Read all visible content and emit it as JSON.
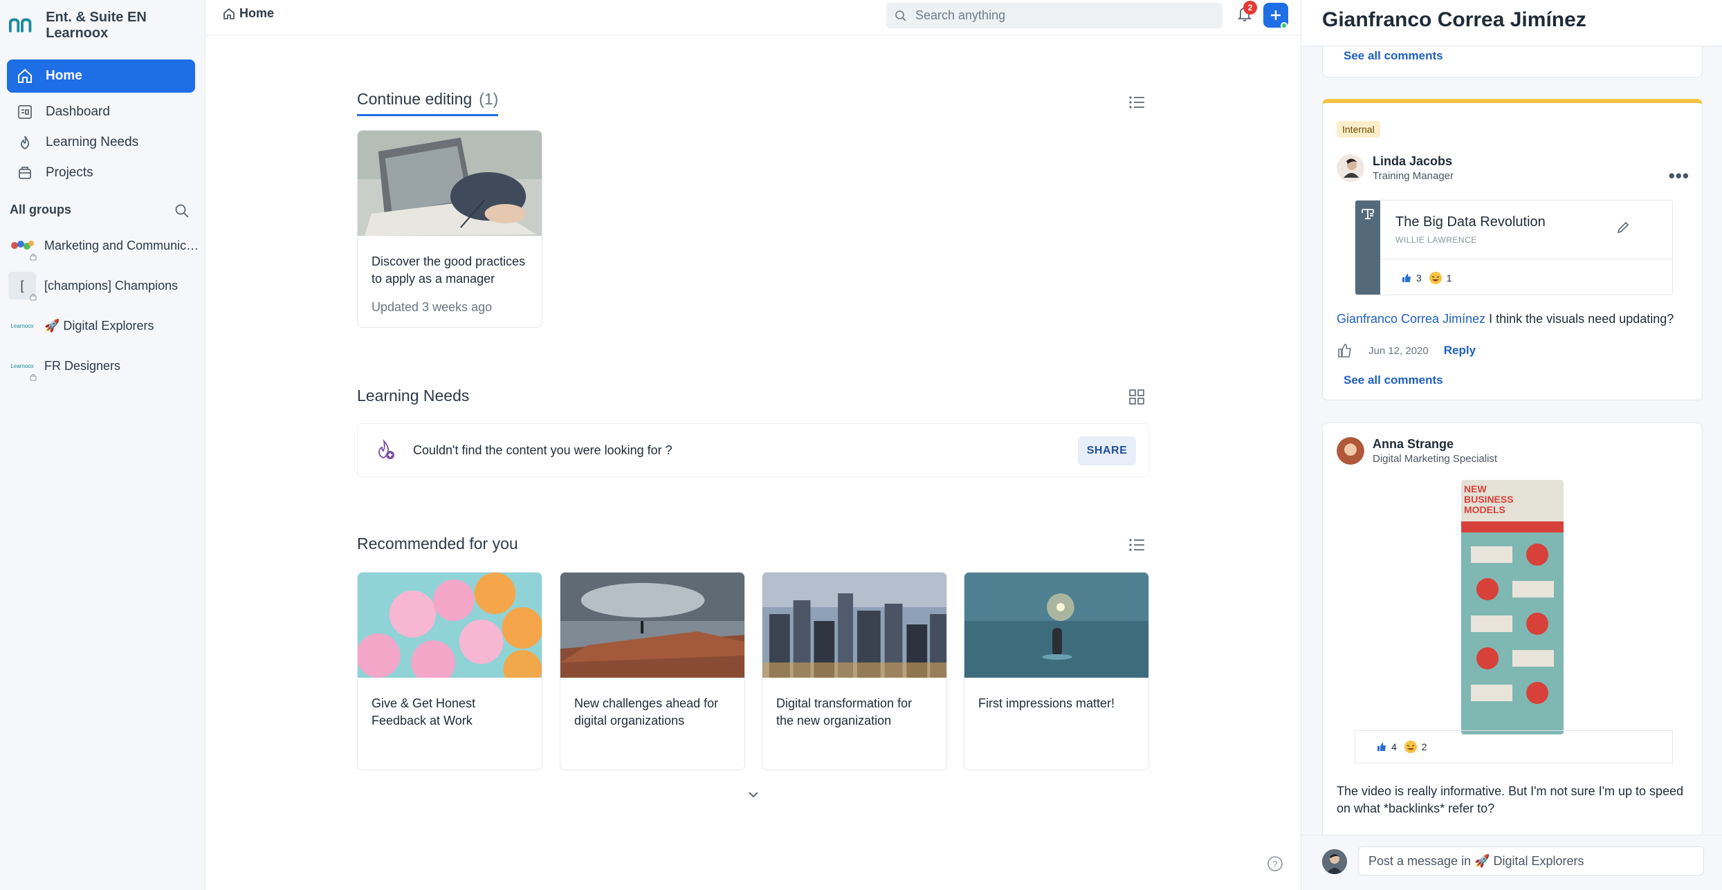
{
  "sidebar": {
    "brand": "Ent. & Suite EN Learnoox",
    "nav": [
      {
        "label": "Home",
        "icon": "home-icon",
        "active": true
      },
      {
        "label": "Dashboard",
        "icon": "dashboard-icon"
      },
      {
        "label": "Learning Needs",
        "icon": "flame-icon"
      },
      {
        "label": "Projects",
        "icon": "projects-icon"
      }
    ],
    "groups_title": "All groups",
    "groups": [
      {
        "name": "Marketing and Communications",
        "avatar": "",
        "locked": true
      },
      {
        "name": "[champions] Champions",
        "avatar": "[",
        "locked": true
      },
      {
        "name": "🚀 Digital Explorers",
        "avatar": "Learnoox",
        "locked": false
      },
      {
        "name": "FR Designers",
        "avatar": "Learnoox",
        "locked": true
      }
    ]
  },
  "topbar": {
    "breadcrumb": "Home",
    "search_placeholder": "Search anything",
    "notifications_count": "2"
  },
  "main": {
    "continue_editing": {
      "title": "Continue editing",
      "count": "(1)",
      "cards": [
        {
          "title": "Discover the good practices to apply as a manager",
          "meta": "Updated 3 weeks ago"
        }
      ]
    },
    "learning_needs": {
      "title": "Learning Needs",
      "prompt": "Couldn't find the content you were looking for ?",
      "share_label": "SHARE"
    },
    "recommended": {
      "title": "Recommended for you",
      "cards": [
        {
          "title": "Give & Get Honest Feedback at Work"
        },
        {
          "title": "New challenges ahead for digital organizations"
        },
        {
          "title": "Digital transformation for the new organization"
        },
        {
          "title": "First impressions matter!"
        }
      ]
    }
  },
  "panel": {
    "name": "Gianfranco Correa Jimínez",
    "see_all_top": "See all comments",
    "post1": {
      "tag": "Internal",
      "author": "Linda Jacobs",
      "role": "Training Manager",
      "embed_title": "The Big Data Revolution",
      "embed_author": "WILLIE LAWRENCE",
      "likes": "3",
      "laughs": "1",
      "comment_author": "Gianfranco Correa Jimínez",
      "comment_text": "I think the visuals need updating?",
      "comment_date": "Jun 12, 2020",
      "reply_label": "Reply",
      "see_all": "See all comments"
    },
    "post2": {
      "author": "Anna Strange",
      "role": "Digital Marketing Specialist",
      "infographic_title": "NEW BUSINESS MODELS",
      "likes": "4",
      "laughs": "2",
      "text": "The video is really informative. But I'm not sure I'm up to speed on what *backlinks* refer to?"
    },
    "composer_placeholder": "Post a message in 🚀 Digital Explorers"
  },
  "colors": {
    "accent": "#1e6ee6",
    "tag_border": "#f5c242"
  }
}
